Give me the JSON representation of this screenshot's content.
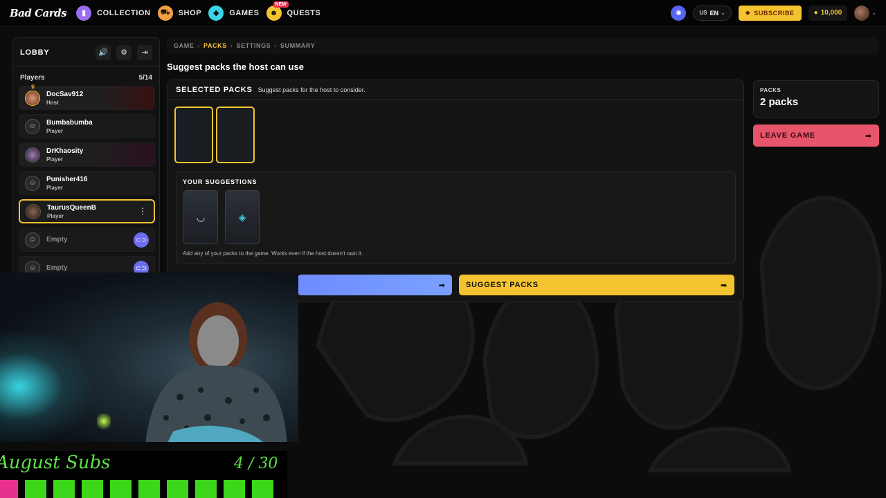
{
  "nav": {
    "logo": "Bad Cards",
    "items": [
      {
        "label": "COLLECTION",
        "icon": "collection-icon",
        "color": "#9b6cf0",
        "glyph": "▮"
      },
      {
        "label": "SHOP",
        "icon": "cart-icon",
        "color": "#f0a040",
        "glyph": "🛒"
      },
      {
        "label": "GAMES",
        "icon": "games-icon",
        "color": "#3bd6e6",
        "glyph": "◆"
      },
      {
        "label": "QUESTS",
        "icon": "quests-icon",
        "color": "#f4c430",
        "glyph": "☻",
        "badge": "NEW"
      }
    ],
    "lang_flag": "US",
    "lang_code": "EN",
    "subscribe": "SUBSCRIBE",
    "coins": "10,000"
  },
  "lobby": {
    "title": "LOBBY",
    "players_label": "Players",
    "players_count": "5/14",
    "players": [
      {
        "name": "DocSav912",
        "role": "Host"
      },
      {
        "name": "Bumbabumba",
        "role": "Player"
      },
      {
        "name": "DrKhaosity",
        "role": "Player"
      },
      {
        "name": "Punisher416",
        "role": "Player"
      },
      {
        "name": "TaurusQueenB",
        "role": "Player"
      }
    ],
    "empty_label": "Empty"
  },
  "breadcrumb": {
    "items": [
      "GAME",
      "PACKS",
      "SETTINGS",
      "SUMMARY"
    ]
  },
  "page": {
    "title": "Suggest packs the host can use",
    "selected_title": "SELECTED PACKS",
    "selected_sub": "Suggest packs for the host to consider.",
    "suggestions_title": "YOUR SUGGESTIONS",
    "suggestions_note": "Add any of your packs to the game. Works even if the host doesn't own it.",
    "suggest_button": "SUGGEST PACKS"
  },
  "right": {
    "packs_label": "PACKS",
    "packs_count": "2 packs",
    "leave_button": "LEAVE GAME"
  },
  "overlay": {
    "subs_title": "August Subs",
    "subs_count": "4 / 30",
    "colors": {
      "progress": "#3cd61a",
      "accent": "#e8318c"
    }
  }
}
